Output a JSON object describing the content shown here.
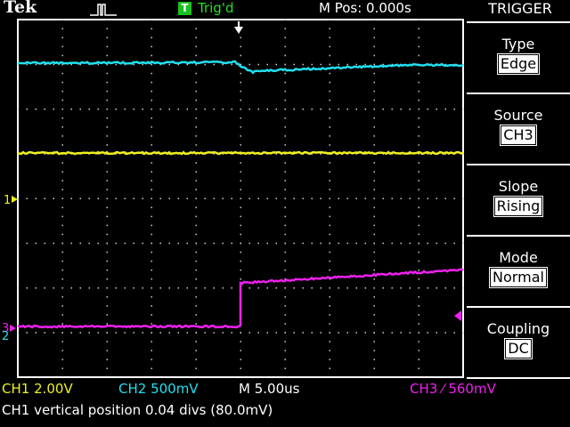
{
  "header": {
    "brand": "Tek",
    "trigger_badge": "T",
    "trigger_status": "Trig'd",
    "horizontal_position": "M Pos: 0.000s"
  },
  "menu": {
    "title": "TRIGGER",
    "items": [
      {
        "label": "Type",
        "value": "Edge"
      },
      {
        "label": "Source",
        "value": "CH3"
      },
      {
        "label": "Slope",
        "value": "Rising"
      },
      {
        "label": "Mode",
        "value": "Normal"
      },
      {
        "label": "Coupling",
        "value": "DC"
      }
    ]
  },
  "status_bar": {
    "ch1": "CH1  2.00V",
    "ch2": "CH2  500mV",
    "timebase": "M 5.00us",
    "ch3_trigger": "CH3 ⁄ 560mV",
    "message": "CH1 vertical position 0.04 divs (80.0mV)"
  },
  "markers": {
    "ch1": "1",
    "ch2": "2",
    "ch3": "3"
  },
  "colors": {
    "ch1": "#f0f020",
    "ch2": "#20e0f0",
    "ch3": "#f020f0",
    "trigger_text": "#22e022",
    "grid": "#cfcfcf",
    "background": "#000000"
  }
}
